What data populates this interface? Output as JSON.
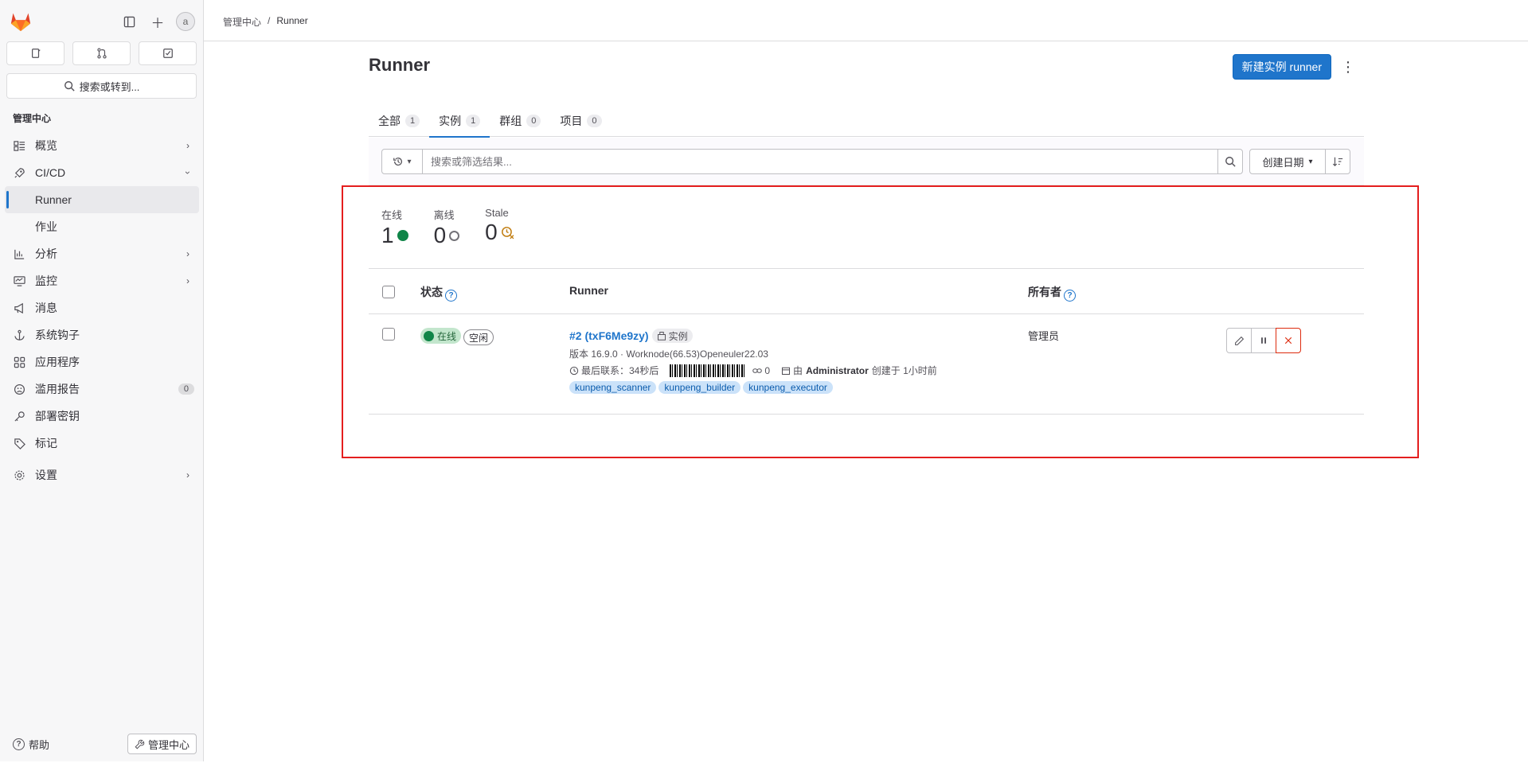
{
  "sidebar": {
    "search_label": "搜索或转到...",
    "section_title": "管理中心",
    "items": [
      {
        "label": "概览",
        "icon": "overview-icon"
      },
      {
        "label": "CI/CD",
        "icon": "rocket-icon"
      },
      {
        "label": "Runner"
      },
      {
        "label": "作业"
      },
      {
        "label": "分析",
        "icon": "analytics-icon"
      },
      {
        "label": "监控",
        "icon": "monitor-icon"
      },
      {
        "label": "消息",
        "icon": "megaphone-icon"
      },
      {
        "label": "系统钩子",
        "icon": "anchor-icon"
      },
      {
        "label": "应用程序",
        "icon": "applications-icon"
      },
      {
        "label": "滥用报告",
        "icon": "abuse-icon",
        "count": "0"
      },
      {
        "label": "部署密钥",
        "icon": "key-icon"
      },
      {
        "label": "标记",
        "icon": "label-icon"
      },
      {
        "label": "设置",
        "icon": "settings-icon"
      }
    ],
    "help_label": "帮助",
    "admin_label": "管理中心"
  },
  "breadcrumb": {
    "root": "管理中心",
    "current": "Runner"
  },
  "page": {
    "title": "Runner",
    "new_runner_label": "新建实例 runner"
  },
  "tabs": [
    {
      "label": "全部",
      "count": "1"
    },
    {
      "label": "实例",
      "count": "1"
    },
    {
      "label": "群组",
      "count": "0"
    },
    {
      "label": "项目",
      "count": "0"
    }
  ],
  "filter": {
    "placeholder": "搜索或筛选结果...",
    "sort_label": "创建日期"
  },
  "stats": [
    {
      "label": "在线",
      "value": "1"
    },
    {
      "label": "离线",
      "value": "0"
    },
    {
      "label": "Stale",
      "value": "0"
    }
  ],
  "table": {
    "headers": {
      "status": "状态",
      "runner": "Runner",
      "owner": "所有者"
    },
    "rows": [
      {
        "status_online": "在线",
        "status_idle": "空闲",
        "name": "#2 (txF6Me9zy)",
        "type_badge": "实例",
        "version_line": "版本 16.9.0 · Worknode(66.53)Openeuler22.03",
        "last_contact": "最后联系：34秒后",
        "jobs_count": "0",
        "created_by_prefix": "由",
        "created_by_user": "Administrator",
        "created_suffix": "创建于 1小时前",
        "tags": [
          "kunpeng_scanner",
          "kunpeng_builder",
          "kunpeng_executor"
        ],
        "owner": "管理员"
      }
    ]
  },
  "colors": {
    "accent": "#1f75cb",
    "online": "#108548",
    "danger": "#dd2b0e",
    "highlight": "#e41e1e"
  }
}
